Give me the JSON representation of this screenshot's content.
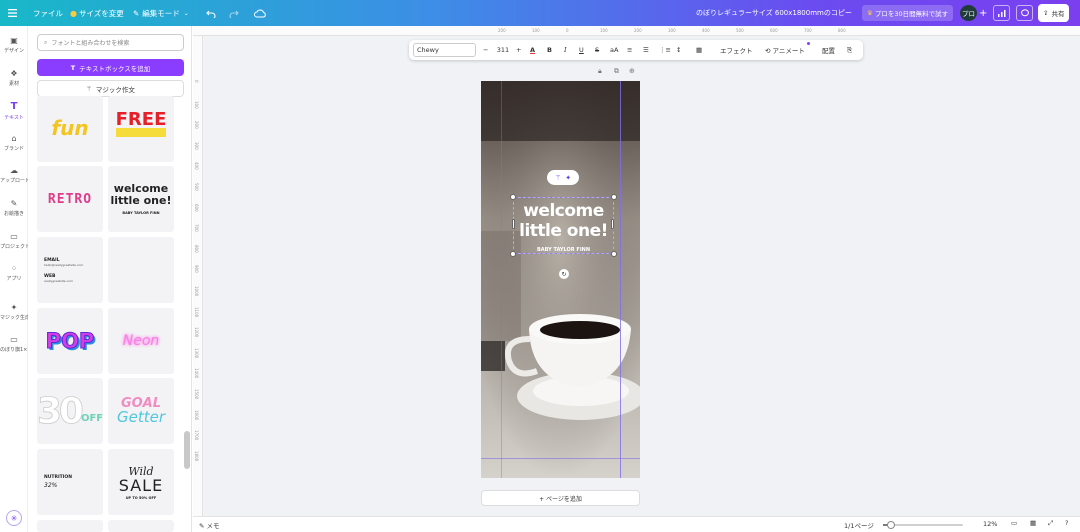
{
  "topbar": {
    "file": "ファイル",
    "resize": "サイズを変更",
    "edit_mode": "編集モード",
    "doc_title": "のぼりレギュラーサイズ 600x1800mmのコピー",
    "trial": "プロを30日間無料で試す",
    "avatar": "プロ",
    "share": "共有"
  },
  "rail": {
    "items": [
      {
        "label": "デザイン",
        "icon": "design-icon"
      },
      {
        "label": "素材",
        "icon": "elements-icon"
      },
      {
        "label": "テキスト",
        "icon": "text-icon"
      },
      {
        "label": "ブランド",
        "icon": "brand-icon"
      },
      {
        "label": "アップロード",
        "icon": "upload-icon"
      },
      {
        "label": "お絵描き",
        "icon": "draw-icon"
      },
      {
        "label": "プロジェクト",
        "icon": "projects-icon"
      },
      {
        "label": "アプリ",
        "icon": "apps-icon"
      },
      {
        "label": "マジック生成",
        "icon": "magic-media-icon"
      },
      {
        "label": "のぼり旗1×...",
        "icon": "folder-icon"
      }
    ]
  },
  "panel": {
    "search_placeholder": "フォントと組み合わせを検索",
    "add_textbox": "テキストボックスを追加",
    "magic_write": "マジック作文",
    "tiles": {
      "fun": "fun",
      "free": "FREE",
      "retro": "RETRO",
      "welcome_l1": "welcome",
      "welcome_l2": "little one!",
      "welcome_sub": "BABY TAYLOR FINN",
      "email_label": "EMAIL",
      "email_value": "hello@reallygreatsite.com",
      "web_label": "WEB",
      "web_value": "reallygreatsite.com",
      "pop": "POP",
      "neon": "Neon",
      "thirty": "30",
      "off": "OFF",
      "goal": "GOAL",
      "getter": "Getter",
      "nutrition": "NUTRITION",
      "pct": "32%",
      "wild": "Wild",
      "sale": "SALE",
      "upto": "UP TO 50% OFF"
    }
  },
  "ruler_top": [
    "200",
    "100",
    "0",
    "100",
    "200",
    "300",
    "400",
    "500",
    "600",
    "700",
    "800"
  ],
  "ruler_left": [
    "0",
    "100",
    "200",
    "300",
    "400",
    "500",
    "600",
    "700",
    "800",
    "900",
    "1000",
    "1100",
    "1200",
    "1300",
    "1400",
    "1500",
    "1600",
    "1700",
    "1800"
  ],
  "toolbar": {
    "font": "Chewy",
    "size": "311",
    "effects": "エフェクト",
    "animate": "アニメート",
    "position": "配置"
  },
  "canvas": {
    "headline_l1": "welcome",
    "headline_l2": "little one!",
    "subline": "BABY TAYLOR FINN",
    "add_page": "+ ページを追加"
  },
  "bottombar": {
    "notes": "メモ",
    "page": "1/1ページ",
    "zoom": "12%",
    "zoom_level": 0.12
  },
  "colors": {
    "accent": "#8b3dff",
    "guide": "#7f6ee8"
  }
}
